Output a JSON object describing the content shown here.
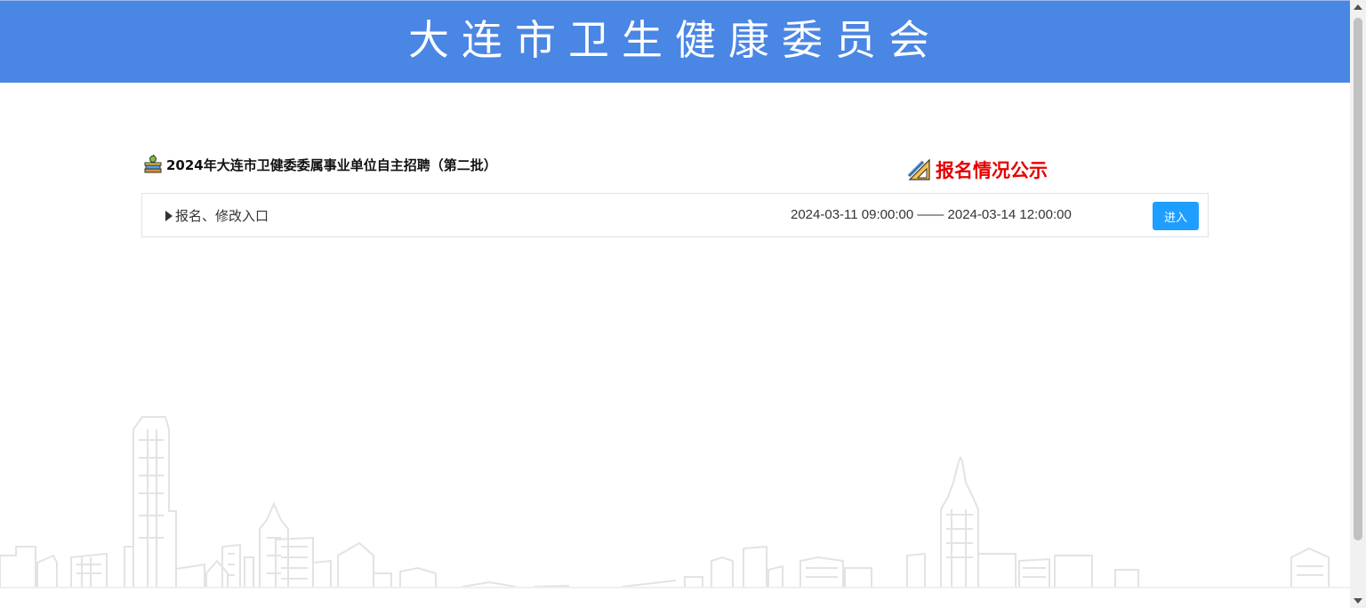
{
  "header": {
    "title": "大连市卫生健康委员会"
  },
  "section": {
    "icon": "books-apple-icon",
    "title": "2024年大连市卫健委委属事业单位自主招聘（第二批）"
  },
  "notice_link": {
    "icon": "pencil-ruler-icon",
    "label": "报名情况公示",
    "color": "#e60000"
  },
  "entry": {
    "label": "报名、修改入口",
    "time_range": "2024-03-11 09:00:00 —— 2024-03-14 12:00:00",
    "button_label": "进入",
    "button_color": "#1e9fff"
  },
  "theme": {
    "header_bg": "#4a86e4"
  }
}
